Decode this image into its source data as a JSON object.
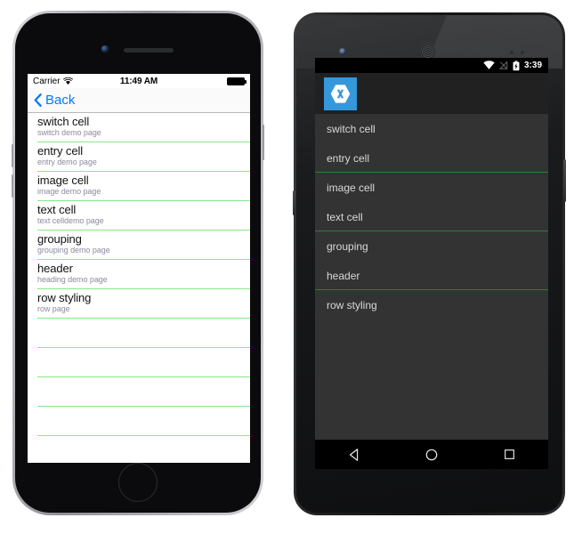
{
  "background_color": "#ffffff",
  "accent_colors": {
    "ios_blue": "#007aff",
    "ios_separator_green": "#84ea84",
    "android_separator_green": "#2e7d32",
    "xamarin_blue": "#3498db",
    "android_list_background": "#333333",
    "android_actionbar": "#212121"
  },
  "iphone": {
    "device_name": "iphone-device",
    "status_bar": {
      "carrier": "Carrier",
      "wifi_icon": "wifi-icon",
      "time": "11:49 AM",
      "battery_icon": "battery-full-icon"
    },
    "nav_bar": {
      "back_icon": "chevron-left-icon",
      "back_label": "Back"
    },
    "list": {
      "rows": [
        {
          "title": "switch cell",
          "subtitle": "switch demo page"
        },
        {
          "title": "entry cell",
          "subtitle": "entry demo page"
        },
        {
          "title": "image cell",
          "subtitle": "image demo page"
        },
        {
          "title": "text cell",
          "subtitle": "text celldemo page"
        },
        {
          "title": "grouping",
          "subtitle": "grouping demo page"
        },
        {
          "title": "header",
          "subtitle": "heading demo page"
        },
        {
          "title": "row styling",
          "subtitle": "row page"
        }
      ],
      "empty_row_count": 4
    },
    "home_button": "home-button"
  },
  "android": {
    "device_name": "android-device",
    "status_bar": {
      "wifi_icon": "wifi-icon",
      "signal_icon": "signal-none-icon",
      "battery_icon": "battery-charging-icon",
      "time": "3:39"
    },
    "action_bar": {
      "app_icon": "xamarin-logo-icon"
    },
    "list": {
      "rows": [
        {
          "title": "switch cell",
          "separator": false
        },
        {
          "title": "entry cell",
          "separator": true
        },
        {
          "title": "image cell",
          "separator": false
        },
        {
          "title": "text cell",
          "separator": true
        },
        {
          "title": "grouping",
          "separator": false
        },
        {
          "title": "header",
          "separator": true
        },
        {
          "title": "row styling",
          "separator": false
        }
      ]
    },
    "nav_bar": {
      "back_icon": "nav-back-triangle-icon",
      "home_icon": "nav-home-circle-icon",
      "recents_icon": "nav-recents-square-icon"
    }
  }
}
